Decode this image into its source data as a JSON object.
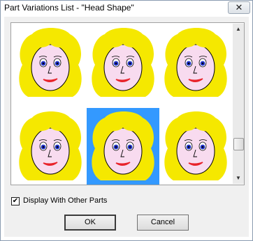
{
  "window": {
    "title": "Part Variations List - \"Head Shape\"",
    "close_label": "✕"
  },
  "list": {
    "items": [
      {
        "name": "variation-1",
        "selected": false
      },
      {
        "name": "variation-2",
        "selected": false
      },
      {
        "name": "variation-3",
        "selected": false
      },
      {
        "name": "variation-4",
        "selected": false
      },
      {
        "name": "variation-5",
        "selected": true
      },
      {
        "name": "variation-6",
        "selected": false
      }
    ],
    "scroll_up_icon": "▲",
    "scroll_down_icon": "▼"
  },
  "options": {
    "display_with_other_parts_label": "Display With Other Parts",
    "display_with_other_parts_checked": true,
    "check_mark": "✔"
  },
  "buttons": {
    "ok": "OK",
    "cancel": "Cancel"
  },
  "colors": {
    "hair": "#f5e800",
    "skin": "#f8dbef",
    "eye_blue": "#2233cc",
    "lips": "#e8232b",
    "selection": "#3399ff"
  }
}
